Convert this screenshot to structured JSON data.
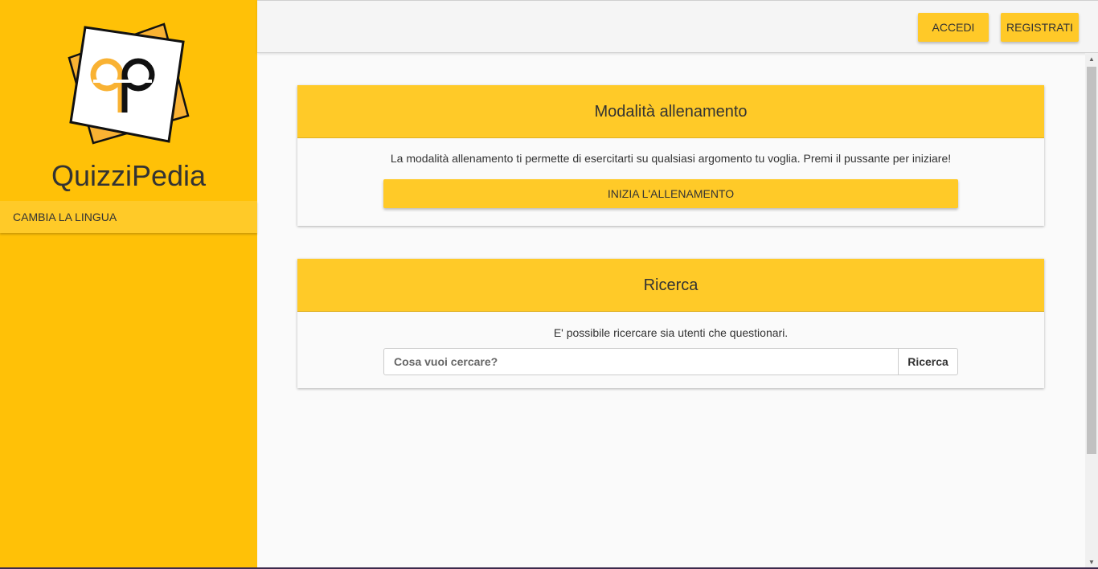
{
  "sidebar": {
    "brand": "QuizziPedia",
    "menu": [
      {
        "label": "CAMBIA LA LINGUA"
      }
    ]
  },
  "topbar": {
    "login_label": "ACCEDI",
    "register_label": "REGISTRATI"
  },
  "training_card": {
    "title": "Modalità allenamento",
    "description": "La modalità allenamento ti permette di esercitarti su qualsiasi argomento tu voglia. Premi il pussante per iniziare!",
    "button_label": "INIZIA L'ALLENAMENTO"
  },
  "search_card": {
    "title": "Ricerca",
    "description": "E' possibile ricercare sia utenti che questionari.",
    "placeholder": "Cosa vuoi cercare?",
    "button_label": "Ricerca"
  },
  "colors": {
    "sidebar": "#ffc107",
    "accent": "#ffca28",
    "logo_orange": "#f9b233",
    "logo_black": "#111111"
  }
}
